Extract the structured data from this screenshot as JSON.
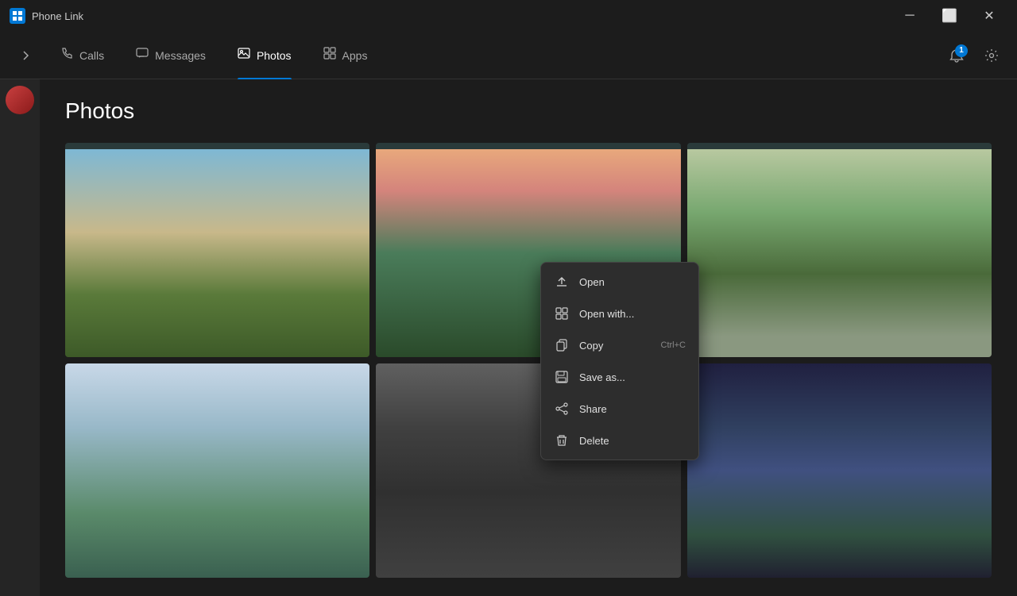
{
  "app": {
    "title": "Phone Link",
    "icon_label": "PL"
  },
  "titlebar": {
    "minimize_label": "─",
    "maximize_label": "⬜",
    "close_label": "✕"
  },
  "nav": {
    "expand_icon": "›",
    "items": [
      {
        "id": "calls",
        "label": "Calls",
        "icon": "📞",
        "active": false
      },
      {
        "id": "messages",
        "label": "Messages",
        "icon": "💬",
        "active": false
      },
      {
        "id": "photos",
        "label": "Photos",
        "icon": "🖼",
        "active": true
      },
      {
        "id": "apps",
        "label": "Apps",
        "icon": "⊞",
        "active": false
      }
    ],
    "notification_count": "1",
    "settings_icon": "⚙"
  },
  "page": {
    "title": "Photos"
  },
  "context_menu": {
    "items": [
      {
        "id": "open",
        "label": "Open",
        "icon": "↗",
        "shortcut": ""
      },
      {
        "id": "open-with",
        "label": "Open with...",
        "icon": "⊞",
        "shortcut": ""
      },
      {
        "id": "copy",
        "label": "Copy",
        "icon": "⧉",
        "shortcut": "Ctrl+C"
      },
      {
        "id": "save-as",
        "label": "Save as...",
        "icon": "💾",
        "shortcut": ""
      },
      {
        "id": "share",
        "label": "Share",
        "icon": "↑",
        "shortcut": ""
      },
      {
        "id": "delete",
        "label": "Delete",
        "icon": "🗑",
        "shortcut": ""
      }
    ]
  },
  "sidebar": {
    "avatar_initial": ""
  }
}
